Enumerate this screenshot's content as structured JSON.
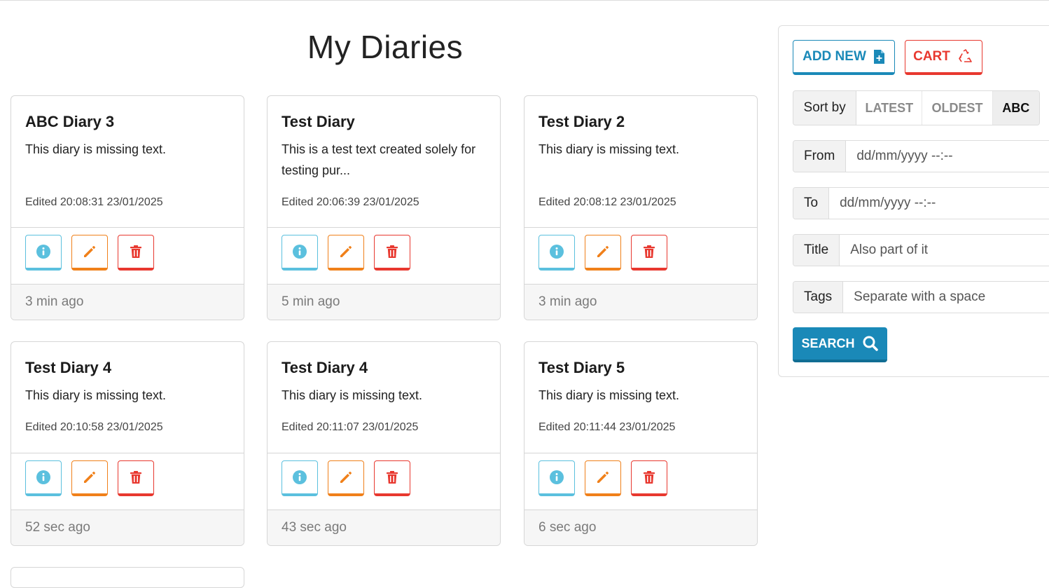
{
  "page": {
    "title": "My Diaries"
  },
  "actions": {
    "info_icon": "info-icon",
    "edit_icon": "pencil-icon",
    "delete_icon": "trash-icon"
  },
  "diaries": [
    {
      "title": "ABC Diary 3",
      "text": "This diary is missing text.",
      "edited": "Edited 20:08:31 23/01/2025",
      "ago": "3 min ago"
    },
    {
      "title": "Test Diary",
      "text": "This is a test text created solely for testing pur...",
      "edited": "Edited 20:06:39 23/01/2025",
      "ago": "5 min ago"
    },
    {
      "title": "Test Diary 2",
      "text": "This diary is missing text.",
      "edited": "Edited 20:08:12 23/01/2025",
      "ago": "3 min ago"
    },
    {
      "title": "Test Diary 4",
      "text": "This diary is missing text.",
      "edited": "Edited 20:10:58 23/01/2025",
      "ago": "52 sec ago"
    },
    {
      "title": "Test Diary 4",
      "text": "This diary is missing text.",
      "edited": "Edited 20:11:07 23/01/2025",
      "ago": "43 sec ago"
    },
    {
      "title": "Test Diary 5",
      "text": "This diary is missing text.",
      "edited": "Edited 20:11:44 23/01/2025",
      "ago": "6 sec ago"
    }
  ],
  "sidebar": {
    "add_new": "ADD NEW",
    "cart": "CART",
    "sort": {
      "label": "Sort by",
      "options": [
        "LATEST",
        "OLDEST",
        "ABC"
      ],
      "active": "ABC"
    },
    "from": {
      "label": "From",
      "placeholder": "dd/mm/yyyy --:--"
    },
    "to": {
      "label": "To",
      "placeholder": "dd/mm/yyyy --:--"
    },
    "title": {
      "label": "Title",
      "placeholder": "Also part of it"
    },
    "tags": {
      "label": "Tags",
      "placeholder": "Separate with a space"
    },
    "search": "SEARCH"
  },
  "colors": {
    "primary": "#1a89b8",
    "info": "#5bc0de",
    "warning": "#f0801a",
    "danger": "#e8382f"
  }
}
